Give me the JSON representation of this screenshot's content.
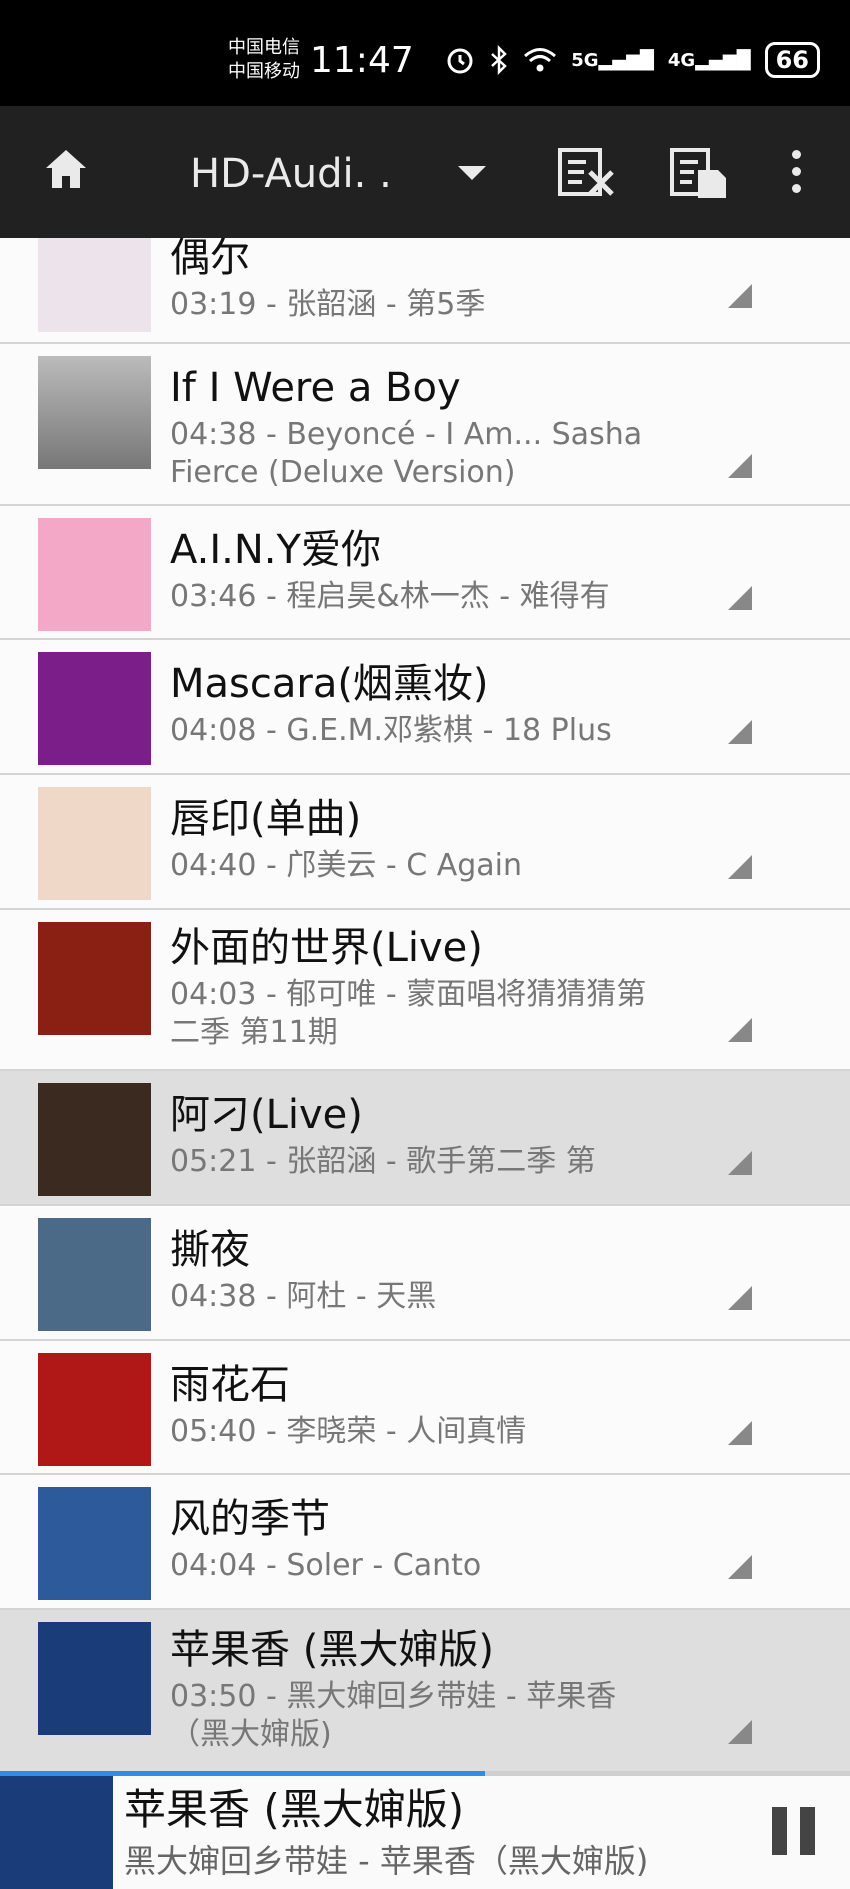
{
  "status_bar": {
    "carrier1": "中国电信",
    "carrier2": "中国移动",
    "time": "11:47",
    "network1": "5G",
    "network2": "4G",
    "battery": "66"
  },
  "app_bar": {
    "title": "HD-Audi. .",
    "icons": [
      "home-icon",
      "dropdown-icon",
      "clear-playlist-icon",
      "playlist-save-icon",
      "more-icon"
    ]
  },
  "songs": [
    {
      "title": "偶尔",
      "meta": "03:19 - 张韶涵 - 第5季",
      "art_color": "#ece4ea",
      "active": false
    },
    {
      "title": "If I Were a Boy",
      "meta": "04:38 - Beyoncé - I Am... Sasha Fierce (Deluxe Version)",
      "art_color": "#9a9a9a",
      "active": false
    },
    {
      "title": "A.I.N.Y爱你",
      "meta": "03:46 - 程启昊&林一杰 - 难得有",
      "art_color": "#f2a8c6",
      "active": false
    },
    {
      "title": "Mascara(烟熏妆)",
      "meta": "04:08 - G.E.M.邓紫棋 - 18 Plus",
      "art_color": "#7b1e8a",
      "active": false
    },
    {
      "title": "唇印(单曲)",
      "meta": "04:40 - 邝美云 - C Again",
      "art_color": "#f0d8c8",
      "active": false
    },
    {
      "title": "外面的世界(Live)",
      "meta": "04:03 - 郁可唯 - 蒙面唱将猜猜猜第二季 第11期",
      "art_color": "#8a1f14",
      "active": false
    },
    {
      "title": "阿刁(Live)",
      "meta": "05:21 - 张韶涵 - 歌手第二季 第",
      "art_color": "#3b2a20",
      "active": true
    },
    {
      "title": "撕夜",
      "meta": "04:38 - 阿杜 - 天黑",
      "art_color": "#4a6a88",
      "active": false
    },
    {
      "title": "雨花石",
      "meta": "05:40 - 李晓荣 - 人间真情",
      "art_color": "#b01818",
      "active": false
    },
    {
      "title": "风的季节",
      "meta": "04:04 - Soler - Canto",
      "art_color": "#2c5a9a",
      "active": false
    },
    {
      "title": "苹果香 (黑大婶版)",
      "meta": "03:50 - 黑大婶回乡带娃 - 苹果香（黑大婶版)",
      "art_color": "#1a3c78",
      "active": true
    }
  ],
  "now_playing": {
    "title": "苹果香 (黑大婶版)",
    "subtitle": "黑大婶回乡带娃 - 苹果香（黑大婶版)",
    "progress": 0.57,
    "art_color": "#1a3c78"
  },
  "colors": {
    "statusbar": "#000000",
    "appbar": "#212121",
    "accent": "#2f8de4"
  }
}
